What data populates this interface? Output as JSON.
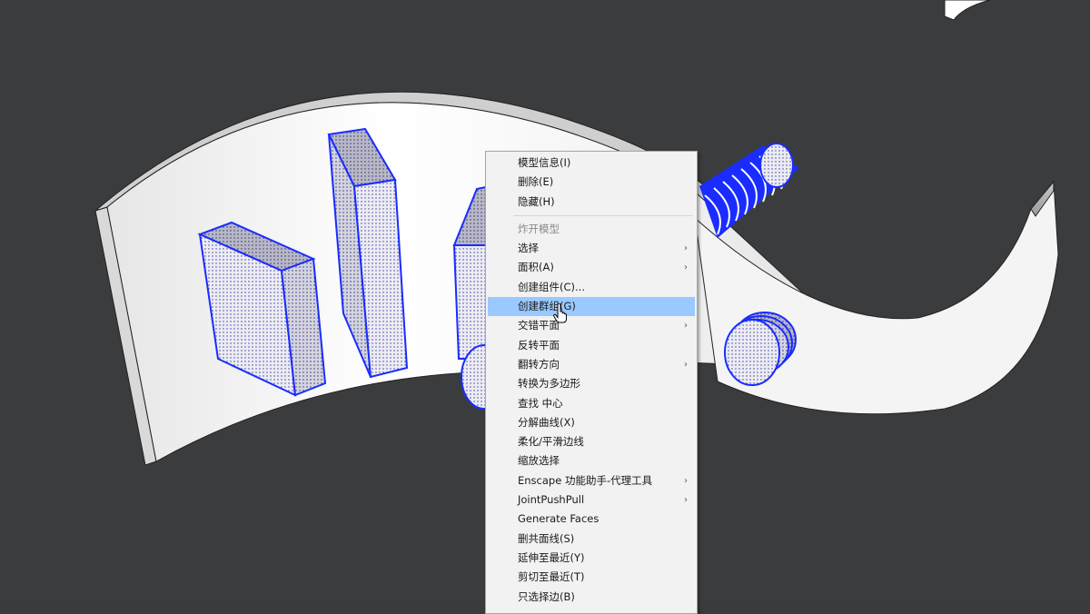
{
  "scene": {
    "description_label": ""
  },
  "context_menu": {
    "items": [
      {
        "label": "模型信息(I)",
        "state": "normal",
        "submenu": false
      },
      {
        "label": "删除(E)",
        "state": "normal",
        "submenu": false
      },
      {
        "label": "隐藏(H)",
        "state": "normal",
        "submenu": false
      },
      {
        "separator": true
      },
      {
        "label": "炸开模型",
        "state": "disabled",
        "submenu": false
      },
      {
        "label": "选择",
        "state": "normal",
        "submenu": true
      },
      {
        "label": "面积(A)",
        "state": "normal",
        "submenu": true
      },
      {
        "label": "创建组件(C)...",
        "state": "normal",
        "submenu": false
      },
      {
        "label": "创建群组(G)",
        "state": "highlighted",
        "submenu": false
      },
      {
        "label": "交错平面",
        "state": "normal",
        "submenu": true
      },
      {
        "label": "反转平面",
        "state": "normal",
        "submenu": false
      },
      {
        "label": "翻转方向",
        "state": "normal",
        "submenu": true
      },
      {
        "label": "转换为多边形",
        "state": "normal",
        "submenu": false
      },
      {
        "label": "查找 中心",
        "state": "normal",
        "submenu": false
      },
      {
        "label": "分解曲线(X)",
        "state": "normal",
        "submenu": false
      },
      {
        "label": "柔化/平滑边线",
        "state": "normal",
        "submenu": false
      },
      {
        "label": "缩放选择",
        "state": "normal",
        "submenu": false
      },
      {
        "label": "Enscape 功能助手-代理工具",
        "state": "normal",
        "submenu": true
      },
      {
        "label": "JointPushPull",
        "state": "normal",
        "submenu": true
      },
      {
        "label": "Generate Faces",
        "state": "normal",
        "submenu": false
      },
      {
        "label": "删共面线(S)",
        "state": "normal",
        "submenu": false
      },
      {
        "label": "延伸至最近(Y)",
        "state": "normal",
        "submenu": false
      },
      {
        "label": "剪切至最近(T)",
        "state": "normal",
        "submenu": false
      },
      {
        "label": "只选择边(B)",
        "state": "normal",
        "submenu": false
      }
    ],
    "submenu_arrow_glyph": "›"
  },
  "colors": {
    "background": "#3b3c3d",
    "selection_edge": "#1a2cff",
    "menu_highlight": "#99c9ff"
  }
}
